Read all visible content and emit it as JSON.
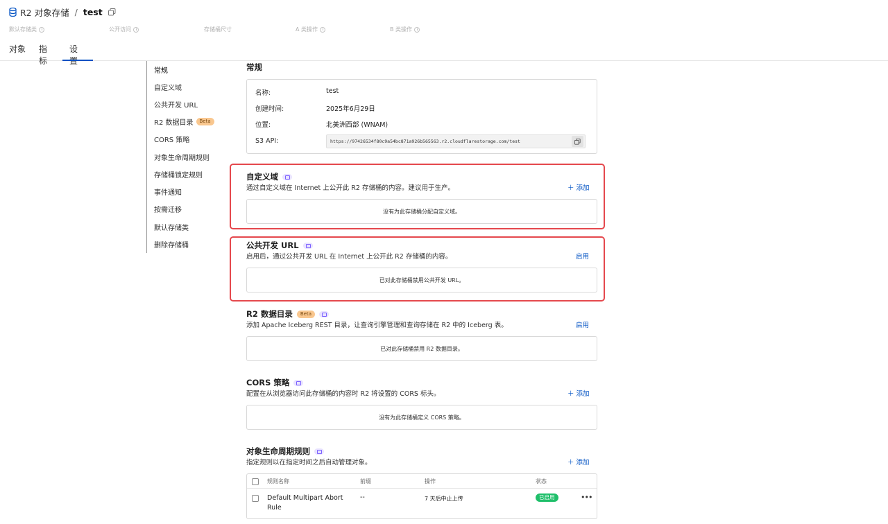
{
  "header": {
    "service": "R2 对象存储",
    "separator": "/",
    "bucket": "test",
    "meta": [
      "默认存储类",
      "公开访问",
      "存储桶尺寸",
      "A 类操作",
      "B 类操作"
    ]
  },
  "tabs": [
    {
      "label": "对象",
      "active": false
    },
    {
      "label": "指标",
      "active": false
    },
    {
      "label": "设置",
      "active": true
    }
  ],
  "sidenav": {
    "items": [
      {
        "label": "常规"
      },
      {
        "label": "自定义域"
      },
      {
        "label": "公共开发 URL"
      },
      {
        "label": "R2 数据目录",
        "badge": "Beta"
      },
      {
        "label": "CORS 策略"
      },
      {
        "label": "对象生命周期规则"
      },
      {
        "label": "存储桶锁定规则"
      },
      {
        "label": "事件通知"
      },
      {
        "label": "按需迁移"
      },
      {
        "label": "默认存储类"
      },
      {
        "label": "删除存储桶"
      }
    ]
  },
  "general": {
    "title": "常规",
    "name_label": "名称:",
    "name_value": "test",
    "created_label": "创建时间:",
    "created_value": "2025年6月29日",
    "location_label": "位置:",
    "location_value": "北美洲西部 (WNAM)",
    "api_label": "S3 API:",
    "api_value": "https://97426534f80c9a54bc871a926b565563.r2.cloudflarestorage.com/test"
  },
  "custom_domain": {
    "title": "自定义域",
    "desc": "通过自定义域在 Internet 上公开此 R2 存储桶的内容。建议用于生产。",
    "action": "＋ 添加",
    "empty": "没有为此存储桶分配自定义域。"
  },
  "public_url": {
    "title": "公共开发 URL",
    "desc": "启用后，通过公共开发 URL 在 Internet 上公开此 R2 存储桶的内容。",
    "action": "启用",
    "empty": "已对此存储桶禁用公共开发 URL。"
  },
  "data_catalog": {
    "title": "R2 数据目录",
    "badge": "Beta",
    "desc": "添加 Apache Iceberg REST 目录，让查询引擎管理和查询存储在 R2 中的 Iceberg 表。",
    "action": "启用",
    "empty": "已对此存储桶禁用 R2 数据目录。"
  },
  "cors": {
    "title": "CORS 策略",
    "desc": "配置在从浏览器访问此存储桶的内容时 R2 将设置的 CORS 标头。",
    "action": "＋ 添加",
    "empty": "没有为此存储桶定义 CORS 策略。"
  },
  "lifecycle": {
    "title": "对象生命周期规则",
    "desc": "指定规则以在指定时间之后自动管理对象。",
    "action": "＋ 添加",
    "columns": [
      "规则名称",
      "前缀",
      "操作",
      "状态"
    ],
    "rows": [
      {
        "name": "Default Multipart Abort Rule",
        "prefix": "--",
        "operation": "7 天后中止上传",
        "status": "已启用"
      }
    ]
  },
  "colors": {
    "accent": "#0051c3",
    "highlight": "#e5484d",
    "status_ok": "#1fbf6a",
    "beta": "#f9c78f"
  }
}
